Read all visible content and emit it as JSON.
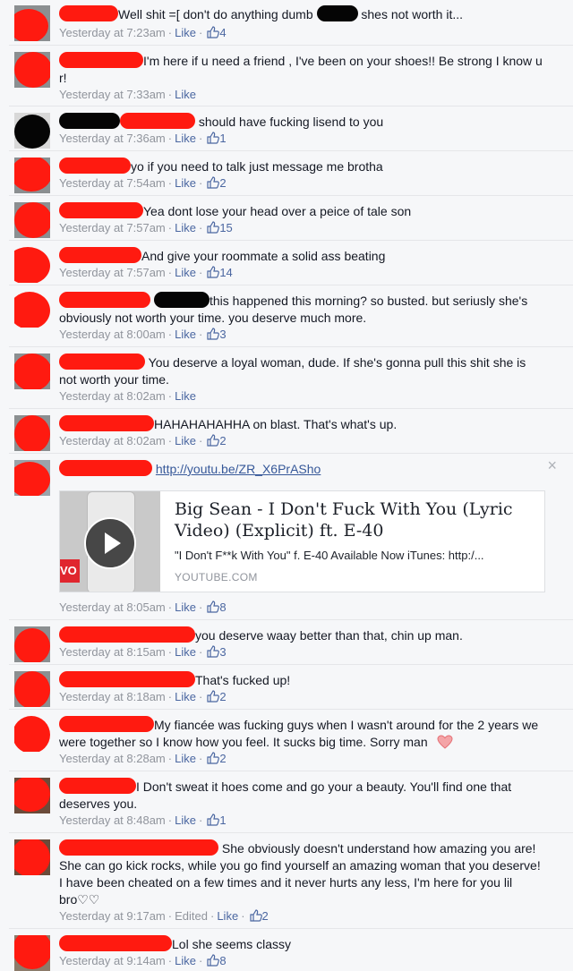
{
  "labels": {
    "like": "Like",
    "edited": "Edited",
    "sep": "·",
    "link_close": "×"
  },
  "colors": {
    "redaction_red": "#ff1a10",
    "redaction_black": "#050505",
    "link_blue": "#4b67a1",
    "meta_gray": "#90949c"
  },
  "comments": [
    {
      "text_1": "Well shit =[ don't do anything dumb",
      "text_2": "shes not worth it...",
      "time": "Yesterday at 7:23am",
      "likes": "4"
    },
    {
      "text": "I'm here if u need a friend , I've been on your shoes!! Be strong I know u r!",
      "time": "Yesterday at 7:33am"
    },
    {
      "text": "should have fucking lisend to you",
      "time": "Yesterday at 7:36am",
      "likes": "1"
    },
    {
      "text": "yo if you need to talk just message me brotha",
      "time": "Yesterday at 7:54am",
      "likes": "2"
    },
    {
      "text": "Yea dont lose your head over a peice of tale son",
      "time": "Yesterday at 7:57am",
      "likes": "15"
    },
    {
      "text": "And give your roommate a solid ass beating",
      "time": "Yesterday at 7:57am",
      "likes": "14"
    },
    {
      "text": "this happened this morning? so busted. but seriusly she's obviously not worth your time. you deserve much more.",
      "time": "Yesterday at 8:00am",
      "likes": "3"
    },
    {
      "text": "You deserve a loyal woman, dude. If she's gonna pull this shit she is not worth your time.",
      "time": "Yesterday at 8:02am"
    },
    {
      "text": "HAHAHAHAHHA on blast. That's what's up.",
      "time": "Yesterday at 8:02am",
      "likes": "2"
    },
    {
      "link_text": "http://youtu.be/ZR_X6PrASho",
      "time": "Yesterday at 8:05am",
      "likes": "8",
      "card": {
        "title": "Big Sean - I Don't Fuck With You (Lyric Video) (Explicit) ft. E-40",
        "desc": "\"I Don't F**k With You\" f. E-40 Available Now iTunes: http:/...",
        "domain": "YOUTUBE.COM",
        "thumb_text": "VO"
      }
    },
    {
      "text": "you deserve waay better than that, chin up man.",
      "time": "Yesterday at 8:15am",
      "likes": "3"
    },
    {
      "text": "That's fucked up!",
      "time": "Yesterday at 8:18am",
      "likes": "2"
    },
    {
      "text": "My fiancée was fucking guys when I wasn't around for the 2 years we were together so I know how you feel. It sucks big time. Sorry man",
      "time": "Yesterday at 8:28am",
      "likes": "2"
    },
    {
      "text": "I Don't sweat it hoes come and go your a beauty. You'll find one that deserves you.",
      "time": "Yesterday at 8:48am",
      "likes": "1"
    },
    {
      "text": "She obviously doesn't understand how amazing you are! She can go kick rocks, while you go find yourself an amazing woman that you deserve! I have been cheated on a few times and it never hurts any less, I'm here for you lil bro♡♡",
      "time": "Yesterday at 9:17am",
      "likes": "2"
    },
    {
      "text": "Lol she seems classy",
      "time": "Yesterday at 9:14am",
      "likes": "8"
    }
  ]
}
